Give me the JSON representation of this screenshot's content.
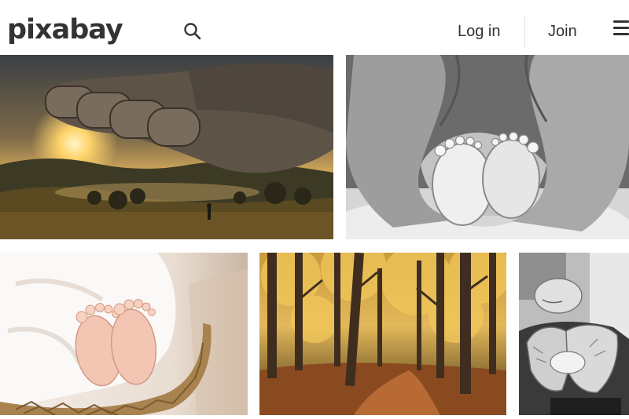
{
  "header": {
    "logo_text": "pixabay",
    "login_label": "Log in",
    "join_label": "Join"
  },
  "icons": {
    "search": "search-icon",
    "menu": "hamburger-menu-icon"
  },
  "colors": {
    "text": "#333333",
    "background": "#ffffff"
  },
  "gallery": {
    "photos": [
      {
        "subject": "giant hand over misty sunset valley"
      },
      {
        "subject": "parent hands cradling baby feet, black and white"
      },
      {
        "subject": "baby feet in wicker basket"
      },
      {
        "subject": "autumn forest path with golden trees"
      },
      {
        "subject": "newborn held in hands, black and white"
      }
    ]
  }
}
